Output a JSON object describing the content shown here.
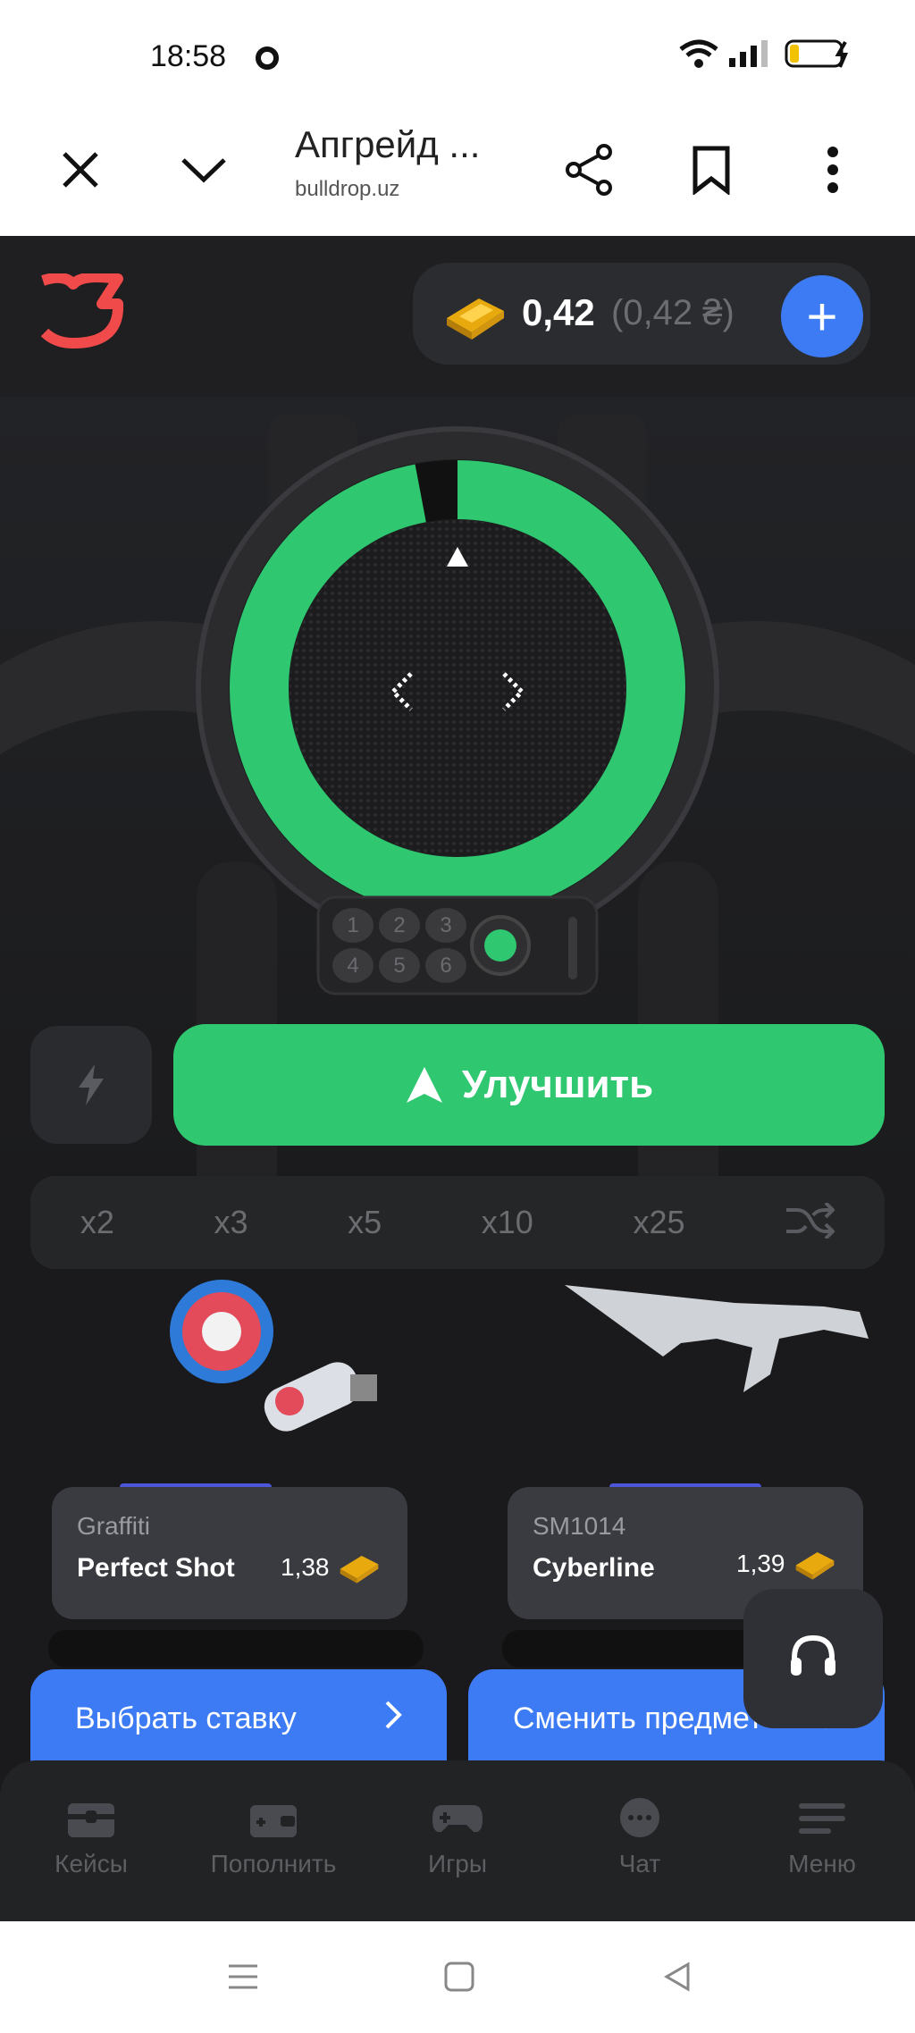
{
  "status_bar": {
    "time": "18:58"
  },
  "browser": {
    "title": "Апгрейд ...",
    "url": "bulldrop.uz"
  },
  "header": {
    "balance": "0,42",
    "balance_sub": "(0,42 ₴)",
    "add_label": "+"
  },
  "upgrade": {
    "button_label": "Улучшить",
    "chance_fraction": 0.97,
    "keypad": [
      "1",
      "2",
      "3",
      "4",
      "5",
      "6"
    ]
  },
  "multipliers": [
    "x2",
    "x3",
    "x5",
    "x10",
    "x25"
  ],
  "cards": [
    {
      "type": "Graffiti",
      "name": "Perfect Shot",
      "price": "1,38",
      "button": "Выбрать ставку"
    },
    {
      "type": "SM1014",
      "name": "Cyberline",
      "price": "1,39",
      "button": "Сменить предмет"
    }
  ],
  "nav": [
    {
      "label": "Кейсы",
      "icon": "chest-icon"
    },
    {
      "label": "Пополнить",
      "icon": "wallet-icon"
    },
    {
      "label": "Игры",
      "icon": "gamepad-icon"
    },
    {
      "label": "Чат",
      "icon": "chat-icon"
    },
    {
      "label": "Меню",
      "icon": "menu-icon"
    }
  ],
  "colors": {
    "accent_green": "#2fc770",
    "accent_blue": "#3d7bf4",
    "brand_red": "#f04a4a"
  }
}
